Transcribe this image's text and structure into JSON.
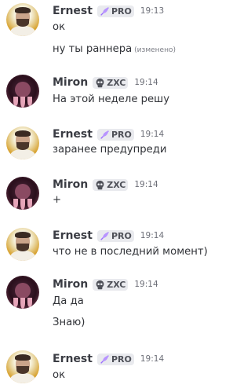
{
  "messages": [
    {
      "author": "Ernest",
      "tag": "PRO",
      "time": "19:13",
      "lines": [
        "ок",
        "ну ты раннера"
      ],
      "edited": "(изменено)"
    },
    {
      "author": "Miron",
      "tag": "ZXC",
      "time": "19:14",
      "lines": [
        "На этой неделе решу"
      ]
    },
    {
      "author": "Ernest",
      "tag": "PRO",
      "time": "19:14",
      "lines": [
        "заранее предупреди"
      ]
    },
    {
      "author": "Miron",
      "tag": "ZXC",
      "time": "19:14",
      "lines": [
        "+"
      ]
    },
    {
      "author": "Ernest",
      "tag": "PRO",
      "time": "19:14",
      "lines": [
        "что не в последний момент)"
      ]
    },
    {
      "author": "Miron",
      "tag": "ZXC",
      "time": "19:14",
      "lines": [
        "Да да",
        "Знаю)"
      ]
    },
    {
      "author": "Ernest",
      "tag": "PRO",
      "time": "19:14",
      "lines": [
        "ок"
      ]
    }
  ],
  "icons": {
    "pro_tag": "feather-icon",
    "zxc_tag": "skull-icon"
  },
  "colors": {
    "pro_feather": "#9b6bff",
    "zxc_skull": "#4e5058"
  }
}
